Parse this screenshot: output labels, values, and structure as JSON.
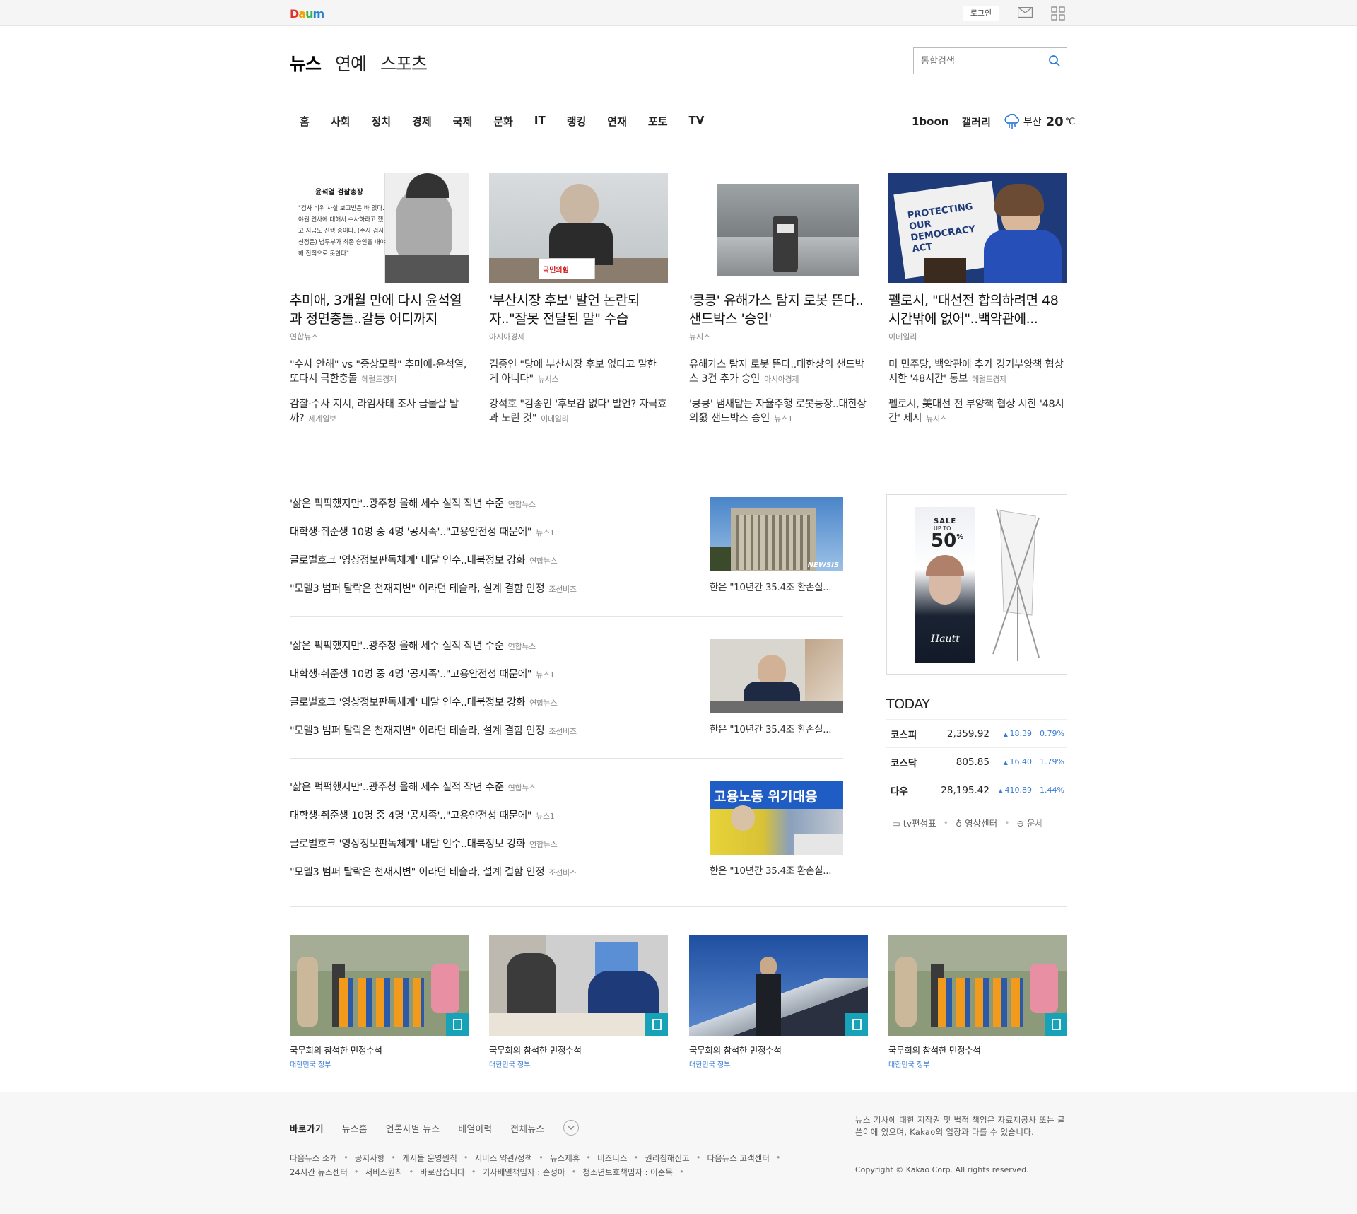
{
  "brand": {
    "logo": "Daum"
  },
  "topbar": {
    "login": "로그인"
  },
  "header": {
    "sections": [
      "뉴스",
      "연예",
      "스포츠"
    ],
    "search_placeholder": "통합검색"
  },
  "nav": {
    "items": [
      "홈",
      "사회",
      "정치",
      "경제",
      "국제",
      "문화",
      "IT",
      "랭킹",
      "연재",
      "포토",
      "TV"
    ],
    "right": [
      "1boon",
      "갤러리"
    ],
    "weather": {
      "city": "부산",
      "temp": "20",
      "unit": "℃"
    }
  },
  "headlines": [
    {
      "title": "추미애, 3개월 만에 다시 윤석열과 정면충돌..갈등 어디까지",
      "source": "연합뉴스",
      "subs": [
        {
          "text": "\"수사 안해\" vs \"중상모략\" 추미애-윤석열, 또다시 극한충돌",
          "source": "헤럴드경제"
        },
        {
          "text": "감찰·수사 지시, 라임사태 조사 급물살 탈까?",
          "source": "세계일보"
        }
      ],
      "image_caption": {
        "header": "윤석열 검찰총장",
        "quote": "\"검사 비위 사실 보고받은 바 없다. 야권 인사에 대해서 수사하라고 했고 지금도 진행 중이다. (수사 검사 선정은) 법무부가 최종 승인을 내야 해 전적으로 못한다\""
      }
    },
    {
      "title": "'부산시장 후보' 발언 논란되자..\"잘못 전달된 말\" 수습",
      "source": "아시아경제",
      "subs": [
        {
          "text": "김종인 \"당에 부산시장 후보 없다고 말한 게 아니다\"",
          "source": "뉴시스"
        },
        {
          "text": "강석호 \"김종인 '후보감 없다' 발언? 자극효과 노린 것\"",
          "source": "이데일리"
        }
      ],
      "image_caption": {
        "sign": "국민의힘"
      }
    },
    {
      "title": "'킁킁' 유해가스 탐지 로봇 뜬다..샌드박스 '승인'",
      "source": "뉴시스",
      "subs": [
        {
          "text": "유해가스 탐지 로봇 뜬다..대한상의 샌드박스 3건 추가 승인",
          "source": "아시아경제"
        },
        {
          "text": "'킁킁' 냄새맡는 자율주행 로봇등장..대한상의發 샌드박스 승인",
          "source": "뉴스1"
        }
      ]
    },
    {
      "title": "펠로시, \"대선전 합의하려면 48시간밖에 없어\"..백악관에...",
      "source": "이데일리",
      "subs": [
        {
          "text": "미 민주당, 백악관에 추가 경기부양책 협상시한 '48시간' 통보",
          "source": "헤럴드경제"
        },
        {
          "text": "펠로시, 美대선 전 부양책 협상 시한 '48시간' 제시",
          "source": "뉴시스"
        }
      ],
      "image_caption": {
        "sign": "PROTECTING OUR DEMOCRACY ACT"
      }
    }
  ],
  "news_blocks": [
    {
      "items": [
        {
          "text": "'삶은 퍽퍽했지만'..광주청 올해 세수 실적 작년 수준",
          "source": "연합뉴스"
        },
        {
          "text": "대학생·취준생 10명 중 4명 '공시족'..\"고용안전성 때문에\"",
          "source": "뉴스1"
        },
        {
          "text": "글로벌호크 '영상정보판독체계' 내달 인수..대북정보 강화",
          "source": "연합뉴스"
        },
        {
          "text": "\"모델3 범퍼 탈락은 천재지변\" 이라던 테슬라, 설계 결함 인정",
          "source": "조선비즈"
        }
      ],
      "caption": "한은 \"10년간 35.4조 환손실...",
      "image_caption": {
        "sign": "NEWSIS"
      }
    },
    {
      "items": [
        {
          "text": "'삶은 퍽퍽했지만'..광주청 올해 세수 실적 작년 수준",
          "source": "연합뉴스"
        },
        {
          "text": "대학생·취준생 10명 중 4명 '공시족'..\"고용안전성 때문에\"",
          "source": "뉴스1"
        },
        {
          "text": "글로벌호크 '영상정보판독체계' 내달 인수..대북정보 강화",
          "source": "연합뉴스"
        },
        {
          "text": "\"모델3 범퍼 탈락은 천재지변\" 이라던 테슬라, 설계 결함 인정",
          "source": "조선비즈"
        }
      ],
      "caption": "한은 \"10년간 35.4조 환손실..."
    },
    {
      "items": [
        {
          "text": "'삶은 퍽퍽했지만'..광주청 올해 세수 실적 작년 수준",
          "source": "연합뉴스"
        },
        {
          "text": "대학생·취준생 10명 중 4명 '공시족'..\"고용안전성 때문에\"",
          "source": "뉴스1"
        },
        {
          "text": "글로벌호크 '영상정보판독체계' 내달 인수..대북정보 강화",
          "source": "연합뉴스"
        },
        {
          "text": "\"모델3 범퍼 탈락은 천재지변\" 이라던 테슬라, 설계 결함 인정",
          "source": "조선비즈"
        }
      ],
      "caption": "한은 \"10년간 35.4조 환손실...",
      "image_caption": {
        "sign": "고용노동 위기대응"
      }
    }
  ],
  "ad": {
    "top": "SALE",
    "mid": "UP TO",
    "big": "50",
    "unit": "%",
    "brand": "Hautt"
  },
  "today": {
    "title": "TODAY",
    "stocks": [
      {
        "name": "코스피",
        "value": "2,359.92",
        "change": "18.39",
        "percent": "0.79%"
      },
      {
        "name": "코스닥",
        "value": "805.85",
        "change": "16.40",
        "percent": "1.79%"
      },
      {
        "name": "다우",
        "value": "28,195.42",
        "change": "410.89",
        "percent": "1.44%"
      }
    ],
    "links": [
      "tv편성표",
      "영상센터",
      "운세"
    ],
    "up_color": "#3a7bd5"
  },
  "photos": [
    {
      "title": "국무회의 참석한 민정수석",
      "source": "대한민국 정부"
    },
    {
      "title": "국무회의 참석한 민정수석",
      "source": "대한민국 정부"
    },
    {
      "title": "국무회의 참석한 민정수석",
      "source": "대한민국 정부"
    },
    {
      "title": "국무회의 참석한 민정수석",
      "source": "대한민국 정부"
    }
  ],
  "footer": {
    "nav": [
      "바로가기",
      "뉴스홈",
      "언론사별 뉴스",
      "배열이력",
      "전체뉴스"
    ],
    "links_row1": [
      "다음뉴스 소개",
      "공지사항",
      "게시물 운영원칙",
      "서비스 약관/정책",
      "뉴스제휴",
      "비즈니스",
      "권리침해신고",
      "다음뉴스 고객센터"
    ],
    "links_row2": [
      "24시간 뉴스센터",
      "서비스원칙",
      "바로잡습니다",
      "기사배열책임자 : 손정아",
      "청소년보호책임자 : 이준목"
    ],
    "note": "뉴스 기사에 대한 저작권 및 법적 책임은 자료제공사 또는 글쓴이에 있으며, Kakao의 입장과 다를 수 있습니다.",
    "copyright": "Copyright © Kakao Corp. All rights reserved."
  }
}
